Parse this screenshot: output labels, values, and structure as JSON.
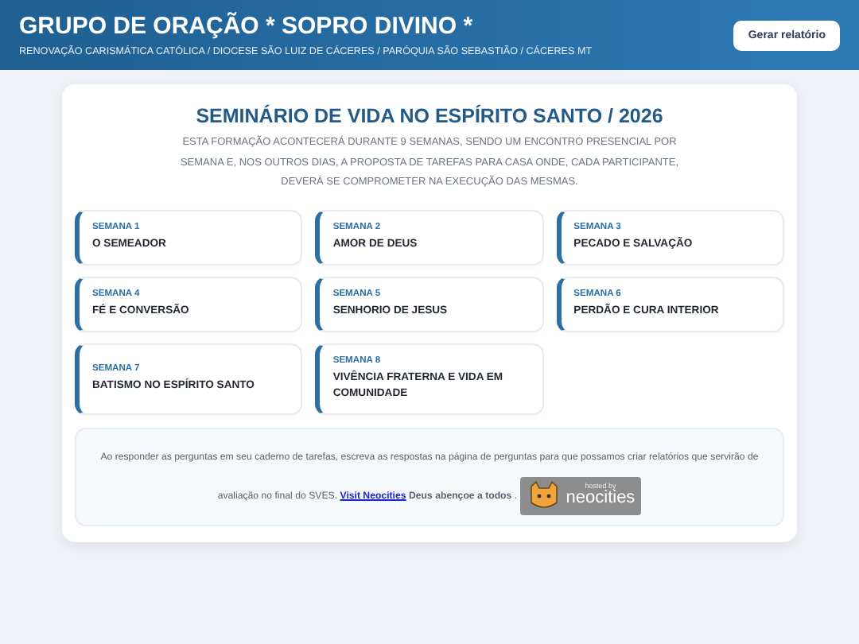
{
  "header": {
    "title": "GRUPO DE ORAÇÃO * SOPRO DIVINO *",
    "subtitle": "RENOVAÇÃO CARISMÁTICA CATÓLICA / DIOCESE SÃO LUIZ DE CÁCERES / PARÓQUIA SÃO SEBASTIÃO / CÁCERES MT",
    "button": "Gerar relatório"
  },
  "main": {
    "title": "SEMINÁRIO DE VIDA NO ESPÍRITO SANTO / 2026",
    "intro": "ESTA FORMAÇÃO ACONTECERÁ DURANTE 9 SEMANAS, SENDO UM ENCONTRO PRESENCIAL POR SEMANA E, NOS OUTROS DIAS, A PROPOSTA DE TAREFAS PARA CASA ONDE, CADA PARTICIPANTE, DEVERÁ SE COMPROMETER NA EXECUÇÃO DAS MESMAS.",
    "weeks": [
      {
        "label": "SEMANA 1",
        "title": "O SEMEADOR"
      },
      {
        "label": "SEMANA 2",
        "title": "AMOR DE DEUS"
      },
      {
        "label": "SEMANA 3",
        "title": "PECADO E SALVAÇÃO"
      },
      {
        "label": "SEMANA 4",
        "title": "FÉ E CONVERSÃO"
      },
      {
        "label": "SEMANA 5",
        "title": "SENHORIO DE JESUS"
      },
      {
        "label": "SEMANA 6",
        "title": "PERDÃO E CURA INTERIOR"
      },
      {
        "label": "SEMANA 7",
        "title": "BATISMO NO ESPÍRITO SANTO"
      },
      {
        "label": "SEMANA 8",
        "title": "VIVÊNCIA FRATERNA E VIDA EM COMUNIDADE"
      }
    ],
    "footer": {
      "text": "Ao responder as perguntas em seu caderno de tarefas, escreva as respostas na página de perguntas para que possamos criar relatórios que servirão de avaliação no final do SVES.",
      "link": "Visit Neocities",
      "closing": "**Deus abençoe a todos** .",
      "badge": {
        "line1": "hosted by",
        "line2": "neocities"
      }
    }
  }
}
